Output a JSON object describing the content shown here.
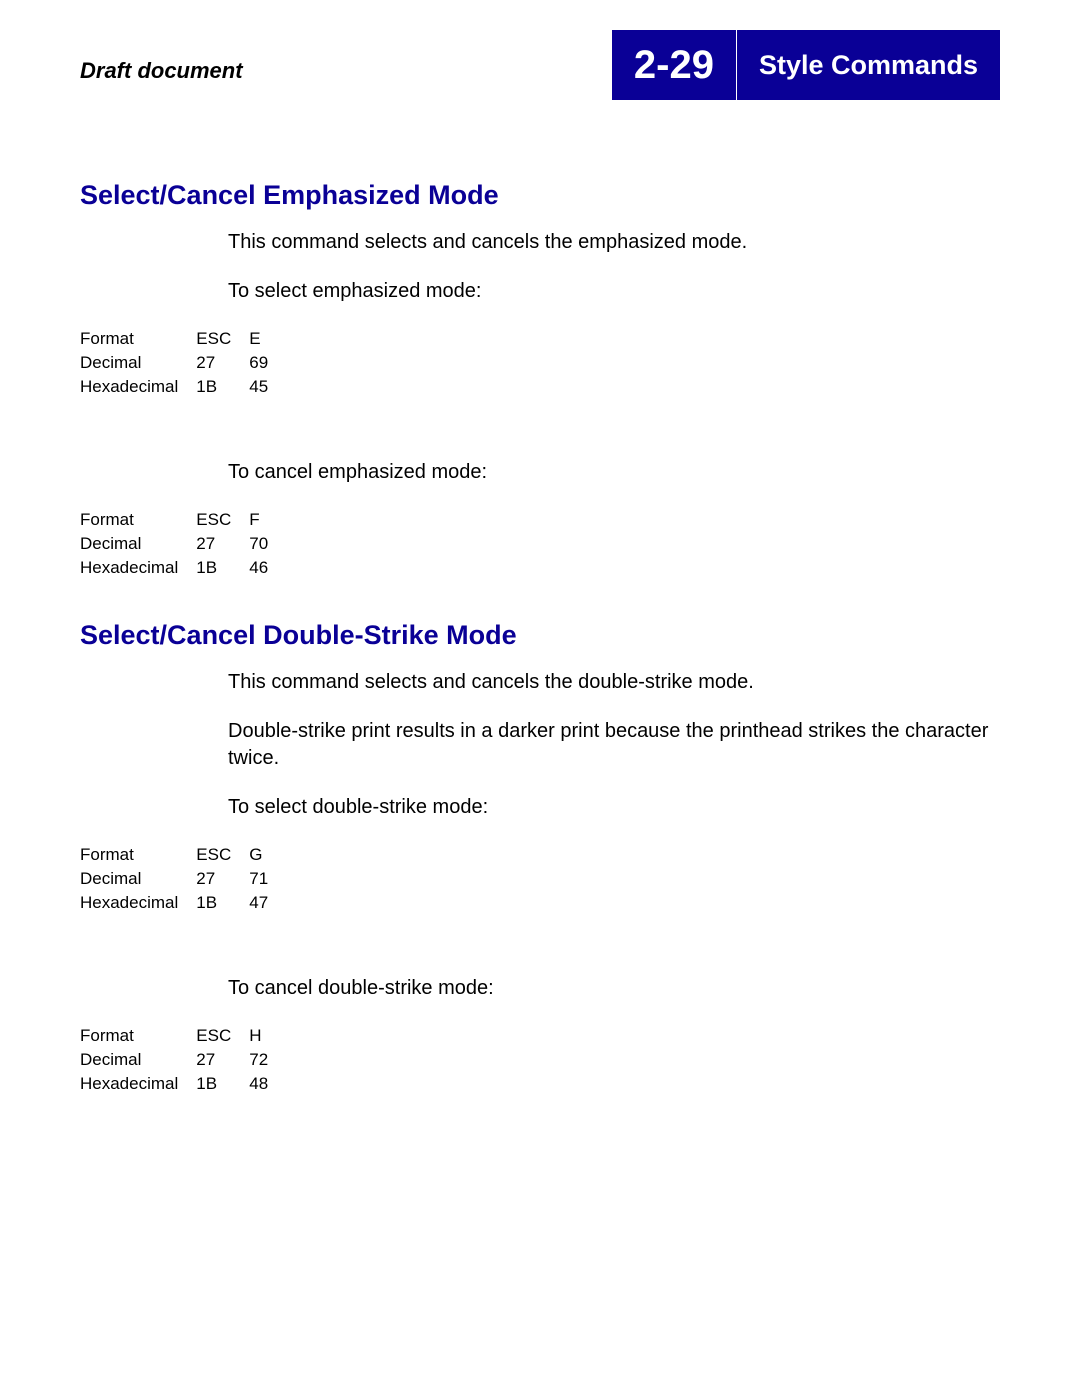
{
  "header": {
    "draft_label": "Draft document",
    "page_number": "2-29",
    "chapter_title": "Style Commands"
  },
  "sections": [
    {
      "heading": "Select/Cancel Emphasized Mode",
      "intro": "This command selects and cancels the emphasized mode.",
      "blocks": [
        {
          "caption": "To select emphasized mode:",
          "rows": [
            {
              "label": "Format",
              "c1": "ESC",
              "c2": "E"
            },
            {
              "label": "Decimal",
              "c1": "27",
              "c2": "69"
            },
            {
              "label": "Hexadecimal",
              "c1": "1B",
              "c2": "45"
            }
          ]
        },
        {
          "caption": "To cancel emphasized mode:",
          "rows": [
            {
              "label": "Format",
              "c1": "ESC",
              "c2": "F"
            },
            {
              "label": "Decimal",
              "c1": "27",
              "c2": "70"
            },
            {
              "label": "Hexadecimal",
              "c1": "1B",
              "c2": "46"
            }
          ]
        }
      ]
    },
    {
      "heading": "Select/Cancel Double-Strike Mode",
      "intro": "This command selects and cancels the double-strike mode.",
      "extra": "Double-strike print results in a darker print because the printhead strikes the character twice.",
      "blocks": [
        {
          "caption": "To select double-strike mode:",
          "rows": [
            {
              "label": "Format",
              "c1": "ESC",
              "c2": "G"
            },
            {
              "label": "Decimal",
              "c1": "27",
              "c2": "71"
            },
            {
              "label": "Hexadecimal",
              "c1": "1B",
              "c2": "47"
            }
          ]
        },
        {
          "caption": "To cancel double-strike mode:",
          "rows": [
            {
              "label": "Format",
              "c1": "ESC",
              "c2": "H"
            },
            {
              "label": "Decimal",
              "c1": "27",
              "c2": "72"
            },
            {
              "label": "Hexadecimal",
              "c1": "1B",
              "c2": "48"
            }
          ]
        }
      ]
    }
  ]
}
